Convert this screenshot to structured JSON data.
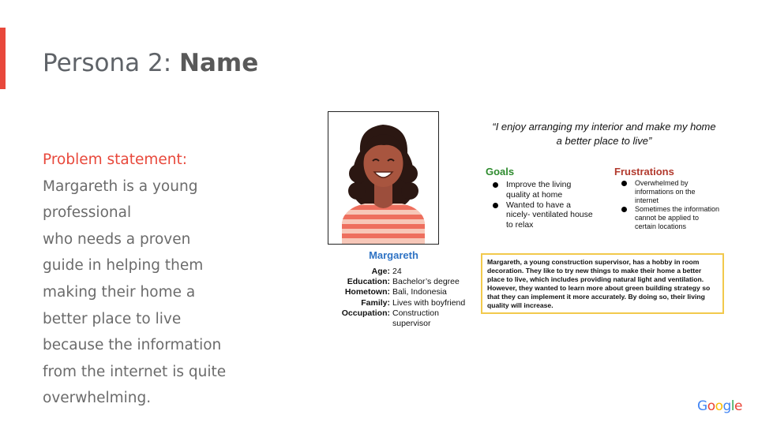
{
  "slide": {
    "title_prefix": "Persona 2: ",
    "title_bold": "Name",
    "problem_label": "Problem statement:",
    "problem_lines": [
      "Margareth is a young",
      "professional",
      "who needs a proven",
      "guide in helping them",
      "making their home a",
      "better place to live",
      "because the information",
      "from the internet is quite",
      "overwhelming."
    ]
  },
  "persona": {
    "name": "Margareth",
    "details": [
      {
        "key": "Age:",
        "value": "24"
      },
      {
        "key": "Education:",
        "value": "Bachelor’s degree"
      },
      {
        "key": "Hometown:",
        "value": "Bali, Indonesia"
      },
      {
        "key": "Family:",
        "value": "Lives with boyfriend"
      },
      {
        "key": "Occupation:",
        "value": "Construction supervisor"
      }
    ],
    "quote": "“I enjoy arranging my interior and make my home a better place to live”",
    "goals_title": "Goals",
    "goals": [
      "Improve the living quality at home",
      "Wanted to have a nicely- ventilated house to relax"
    ],
    "frustrations_title": "Frustrations",
    "frustrations": [
      "Overwhelmed by informations on the internet",
      "Sometimes the information cannot be applied to certain locations"
    ],
    "story": "Margareth, a young construction supervisor, has a hobby in room decoration. They like to try new things to make their home a better place to live, which includes providing natural light and ventilation. However, they wanted to learn more about green building strategy so that they can implement it more accurately. By doing so, their living quality will increase."
  },
  "branding": {
    "logo_letters": [
      "G",
      "o",
      "o",
      "g",
      "l",
      "e"
    ],
    "logo_colors": [
      "#4285F4",
      "#EA4335",
      "#FBBC05",
      "#4285F4",
      "#34A853",
      "#EA4335"
    ]
  },
  "colors": {
    "accent": "#e8483b",
    "goals": "#2e8b2e",
    "frustrations": "#b23a2e",
    "name": "#2f73c4",
    "story_border": "#f2c94c"
  }
}
